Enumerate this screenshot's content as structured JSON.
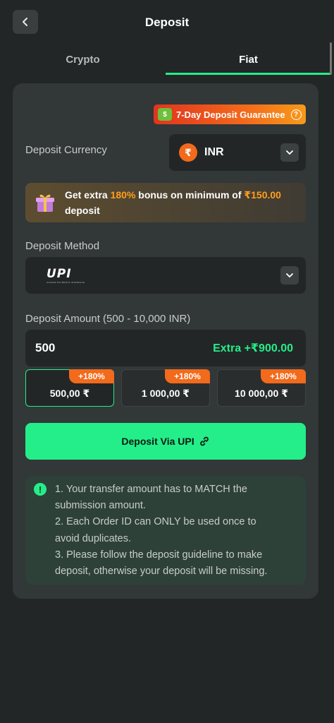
{
  "header": {
    "title": "Deposit",
    "back_icon": "chevron-left-icon"
  },
  "tabs": [
    {
      "label": "Crypto",
      "active": false
    },
    {
      "label": "Fiat",
      "active": true
    }
  ],
  "guarantee": {
    "label": "7-Day Deposit Guarantee",
    "help_glyph": "?"
  },
  "currency": {
    "label": "Deposit Currency",
    "symbol": "₹",
    "code": "INR"
  },
  "bonus": {
    "prefix": "Get extra ",
    "percent": "180%",
    "middle": " bonus on minimum of ",
    "minimum": "₹150.00",
    "suffix": " deposit"
  },
  "method": {
    "label": "Deposit Method",
    "logo_text": "UPI",
    "logo_subtext": "UNIFIED PAYMENTS INTERFACE"
  },
  "amount": {
    "label": "Deposit Amount (500 - 10,000 INR)",
    "value": "500",
    "extra": "Extra +₹900.00"
  },
  "presets": [
    {
      "tag": "+180%",
      "value": "500,00 ₹",
      "selected": true
    },
    {
      "tag": "+180%",
      "value": "1 000,00 ₹",
      "selected": false
    },
    {
      "tag": "+180%",
      "value": "10 000,00 ₹",
      "selected": false
    }
  ],
  "deposit_button": {
    "label": "Deposit Via UPI"
  },
  "notice": {
    "icon_glyph": "!",
    "lines": [
      "1. Your transfer amount has to MATCH the",
      "submission amount.",
      "2. Each Order ID can ONLY be used once to",
      "avoid duplicates.",
      "3. Please follow the deposit guideline to make",
      "deposit, otherwise your deposit will be missing."
    ]
  },
  "colors": {
    "accent": "#24ee89",
    "orange": "#f26a1b",
    "background": "#232626",
    "card": "#323738"
  }
}
